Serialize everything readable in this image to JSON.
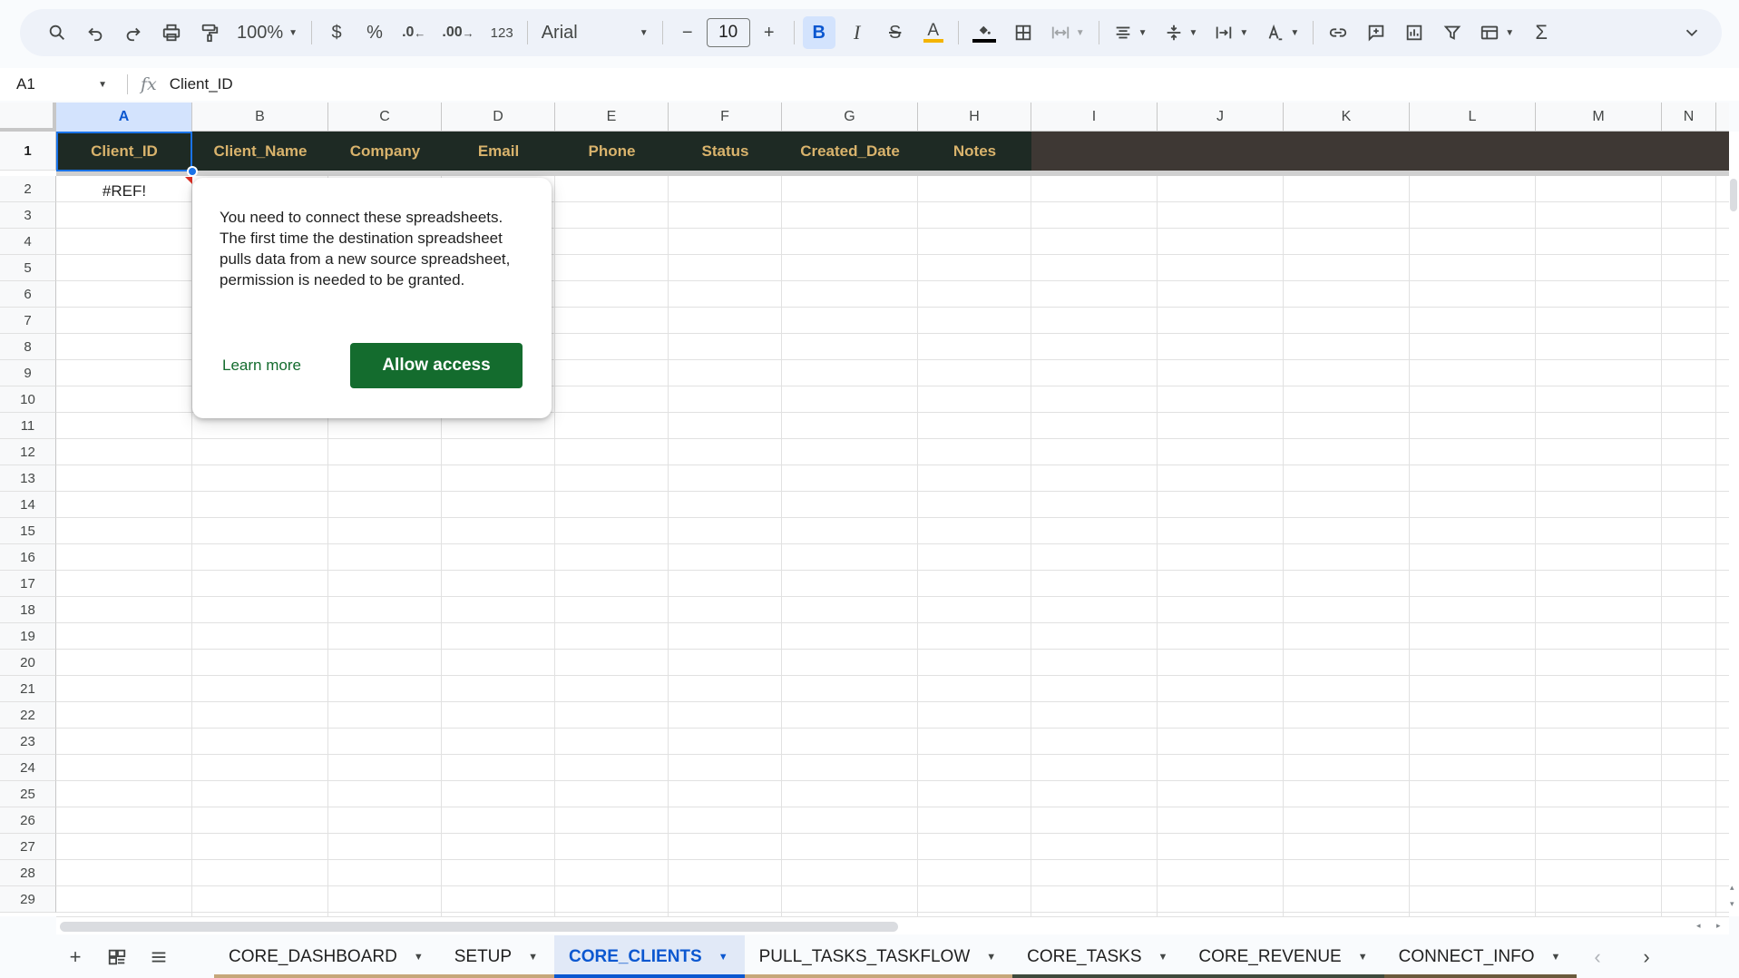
{
  "toolbar": {
    "zoom": "100%",
    "currency_symbol": "$",
    "percent_symbol": "%",
    "decrease_decimal": ".0",
    "increase_decimal": ".00",
    "number_format": "123",
    "font_family": "Arial",
    "font_size": "10",
    "bold_label": "B",
    "italic_label": "I",
    "strike_label": "S",
    "text_color_label": "A",
    "text_color_accent": "#f4b400"
  },
  "formula_bar": {
    "cell_ref": "A1",
    "fx_label": "fx",
    "content": "Client_ID"
  },
  "grid": {
    "columns": [
      "A",
      "B",
      "C",
      "D",
      "E",
      "F",
      "G",
      "H",
      "I",
      "J",
      "K",
      "L",
      "M",
      "N"
    ],
    "selected_column": "A",
    "rows": [
      "1",
      "2",
      "3",
      "4",
      "5",
      "6",
      "7",
      "8",
      "9",
      "10",
      "11",
      "12",
      "13",
      "14",
      "15",
      "16",
      "17",
      "18",
      "19",
      "20",
      "21",
      "22",
      "23",
      "24",
      "25",
      "26",
      "27",
      "28",
      "29"
    ],
    "header_cells": [
      "Client_ID",
      "Client_Name",
      "Company",
      "Email",
      "Phone",
      "Status",
      "Created_Date",
      "Notes"
    ],
    "a2_value": "#REF!",
    "colors": {
      "header_bg": "#1e2a24",
      "header_bg_extended": "#3e3834",
      "header_text": "#d9b36c",
      "selection": "#1a73e8",
      "error_marker": "#d93025"
    }
  },
  "popup": {
    "message": "You need to connect these spreadsheets. The first time the destination spreadsheet pulls data from a new source spreadsheet, permission is needed to be granted.",
    "learn_more": "Learn more",
    "allow_button": "Allow access",
    "accent": "#146c2e"
  },
  "sheet_tabs": {
    "tabs": [
      {
        "label": "CORE_DASHBOARD",
        "active": false,
        "color": "#c6a77a"
      },
      {
        "label": "SETUP",
        "active": false,
        "color": "#c6a77a"
      },
      {
        "label": "CORE_CLIENTS",
        "active": true,
        "color": "#0b57d0"
      },
      {
        "label": "PULL_TASKS_TASKFLOW",
        "active": false,
        "color": "#c6a77a"
      },
      {
        "label": "CORE_TASKS",
        "active": false,
        "color": "#3f4a3c"
      },
      {
        "label": "CORE_REVENUE",
        "active": false,
        "color": "#3f4a3c"
      },
      {
        "label": "CONNECT_INFO",
        "active": false,
        "color": "#6b5a3c"
      }
    ]
  },
  "icons": [
    "search-icon",
    "undo-icon",
    "redo-icon",
    "print-icon",
    "paint-format-icon",
    "minus-icon",
    "plus-icon",
    "fill-color-icon",
    "borders-icon",
    "merge-icon",
    "align-icon",
    "valign-icon",
    "wrap-icon",
    "rotate-icon",
    "link-icon",
    "comment-icon",
    "chart-icon",
    "filter-icon",
    "table-icon",
    "functions-icon",
    "collapse-icon",
    "add-sheet-icon",
    "all-sheets-icon",
    "sheet-menu-icon",
    "scroll-left-icon",
    "scroll-right-icon"
  ]
}
